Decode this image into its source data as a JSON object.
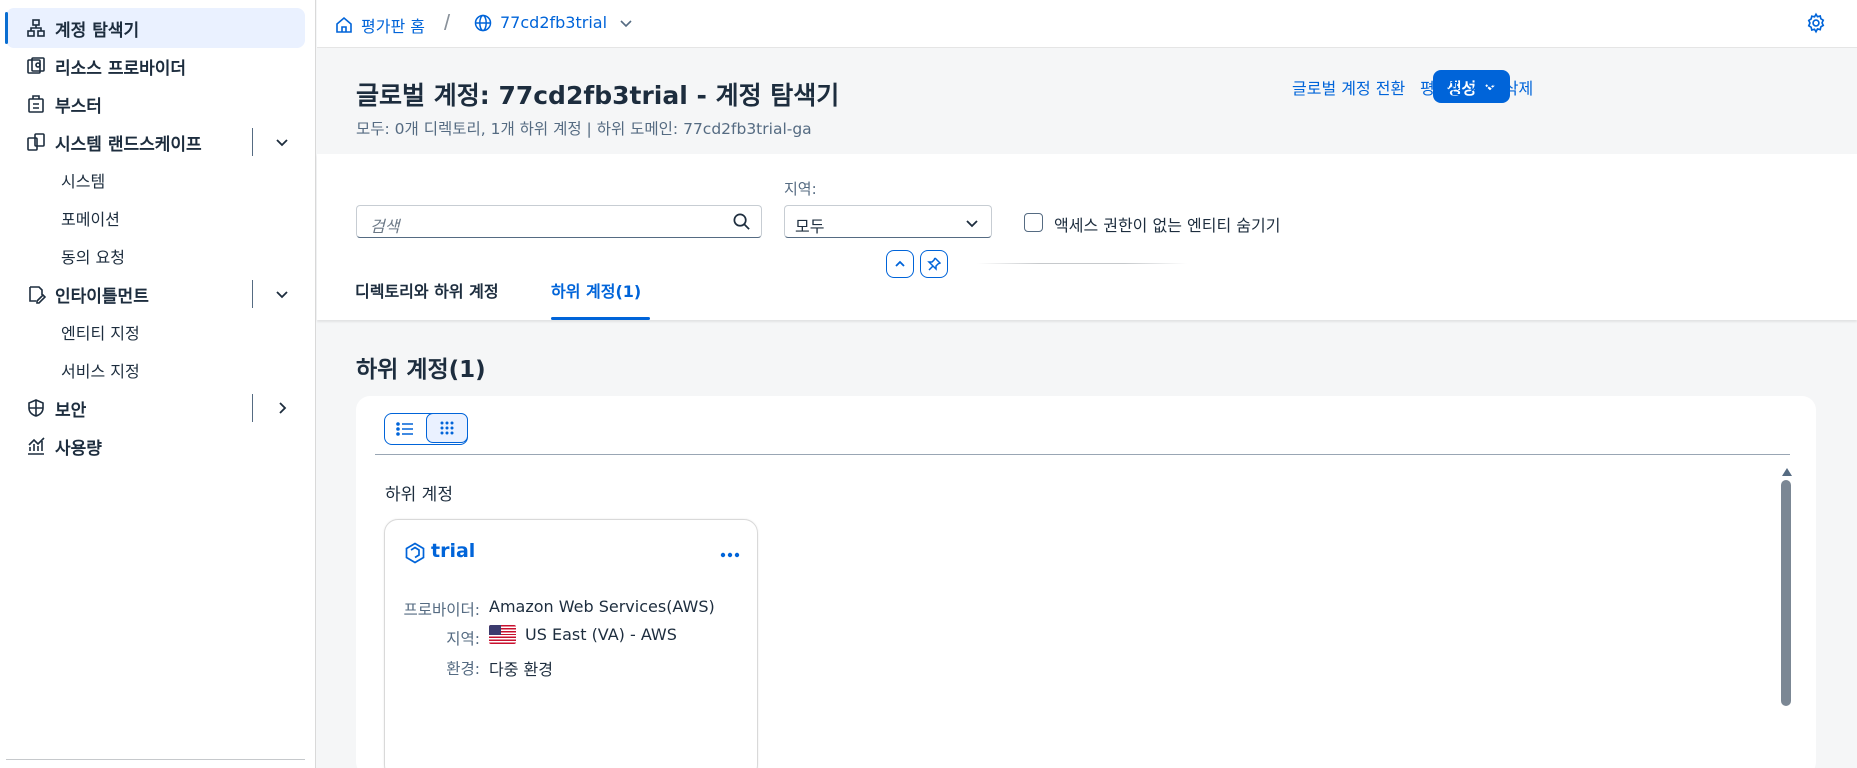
{
  "sidebar": {
    "items": [
      {
        "label": "계정 탐색기",
        "icon": "hierarchy-icon",
        "active": true
      },
      {
        "label": "리소스 프로바이더",
        "icon": "resource-provider-icon"
      },
      {
        "label": "부스터",
        "icon": "booster-icon"
      },
      {
        "label": "시스템 랜드스케이프",
        "icon": "system-landscape-icon",
        "expandable": true
      },
      {
        "label": "시스템",
        "sub": true
      },
      {
        "label": "포메이션",
        "sub": true
      },
      {
        "label": "동의 요청",
        "sub": true
      },
      {
        "label": "인타이틀먼트",
        "icon": "entitlement-icon",
        "expandable": true
      },
      {
        "label": "엔티티 지정",
        "sub": true
      },
      {
        "label": "서비스 지정",
        "sub": true
      },
      {
        "label": "보안",
        "icon": "shield-icon",
        "expandable": true
      },
      {
        "label": "사용량",
        "icon": "usage-chart-icon"
      }
    ]
  },
  "topbar": {
    "home_label": "평가판 홈",
    "account_label": "77cd2fb3trial",
    "separator": "/"
  },
  "header": {
    "title_prefix": "글로벌 계정",
    "title_colon": ":",
    "title_account": "77cd2fb3trial -",
    "title_suffix": "계정 탐색기",
    "subtitle": "모두: 0개 디렉토리, 1개 하위 계정 | 하위 도메인: 77cd2fb3trial-ga",
    "create_button": "생성",
    "switch_link": "글로벌 계정 전환",
    "delete_link": "평가판 계정 삭제"
  },
  "filters": {
    "search_placeholder": "검색",
    "region_label": "지역:",
    "region_value": "모두",
    "hide_checkbox_label": "액세스 권한이 없는 엔티티 숨기기"
  },
  "tabs": [
    {
      "label": "디렉토리와 하위 계정",
      "selected": false
    },
    {
      "label": "하위 계정(1)",
      "selected": true
    }
  ],
  "content": {
    "title": "하위 계정",
    "title_count": "(1)",
    "group_label": "하위 계정"
  },
  "card": {
    "title": "trial",
    "provider_label": "프로바이더:",
    "provider_value": "Amazon Web Services(AWS)",
    "region_label": "지역:",
    "region_value": "US East (VA) - AWS",
    "env_label": "환경:",
    "env_value": "다중 환경"
  },
  "colors": {
    "accent": "#0064d9",
    "text": "#1d2d3e",
    "secondary_text": "#556b82",
    "active_nav_bg": "#eaf1ff"
  }
}
